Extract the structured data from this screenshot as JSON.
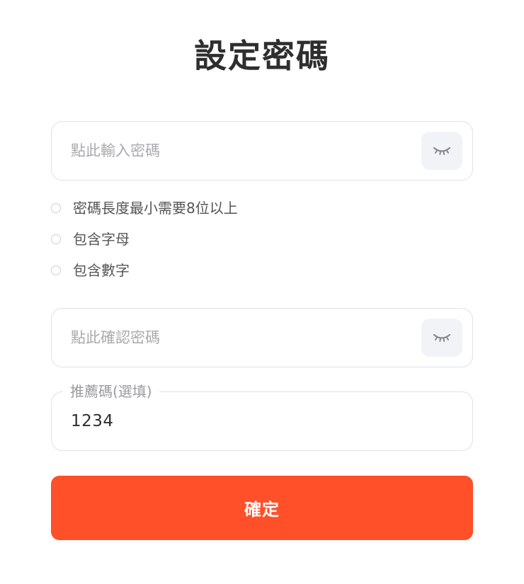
{
  "page": {
    "title": "設定密碼"
  },
  "password": {
    "placeholder": "點此輸入密碼",
    "value": "",
    "toggle_icon": "eye-closed-icon"
  },
  "rules": [
    {
      "label": "密碼長度最小需要8位以上",
      "met": false
    },
    {
      "label": "包含字母",
      "met": false
    },
    {
      "label": "包含數字",
      "met": false
    }
  ],
  "confirm_password": {
    "placeholder": "點此確認密碼",
    "value": "",
    "toggle_icon": "eye-closed-icon"
  },
  "referral": {
    "label": "推薦碼(選填)",
    "value": "1234"
  },
  "submit": {
    "label": "確定"
  },
  "colors": {
    "accent": "#ff5029",
    "border": "#e2e2e6",
    "placeholder": "#a9a9b0"
  }
}
